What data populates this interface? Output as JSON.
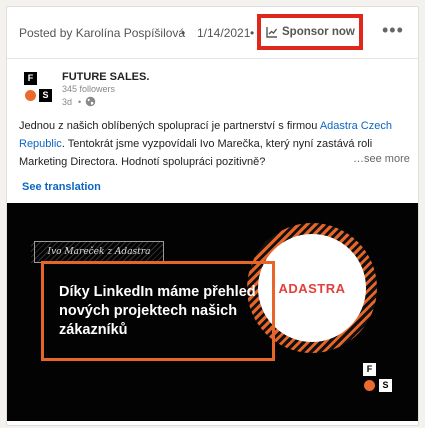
{
  "header": {
    "posted_by": "Posted by Karolína Pospíšilová",
    "separator": "•",
    "date": "1/14/2021",
    "sponsor_label": "Sponsor now",
    "more_label": "•••"
  },
  "author": {
    "logo_letters": [
      "F",
      "S"
    ],
    "name": "FUTURE SALES.",
    "followers": "345 followers",
    "age": "3d",
    "separator": "•"
  },
  "post": {
    "line1_text": "Jednou z našich oblíbených spoluprací je partnerství s firmou ",
    "line1_link": "Adastra Czech",
    "line2_link": "Republic",
    "line2_text": ". Tentokrát jsme vyzpovídali Ivo Marečka, který nyní zastává roli",
    "line3_text": "Marketing Directora. Hodnotí spolupráci pozitivně?",
    "see_more": "…see more",
    "see_translation": "See translation"
  },
  "media": {
    "script_caption": "Ivo Mareček z Adastra",
    "headline": "Díky LinkedIn máme přehled o nových projektech našich zákazníků",
    "brand": "ADASTRA",
    "logo_letters": [
      "F",
      "S"
    ]
  },
  "colors": {
    "highlight_red": "#e0271b",
    "link_blue": "#0a66c2",
    "accent_orange": "#e8652a"
  },
  "icons": [
    "chart-icon",
    "more-icon",
    "globe-icon"
  ]
}
